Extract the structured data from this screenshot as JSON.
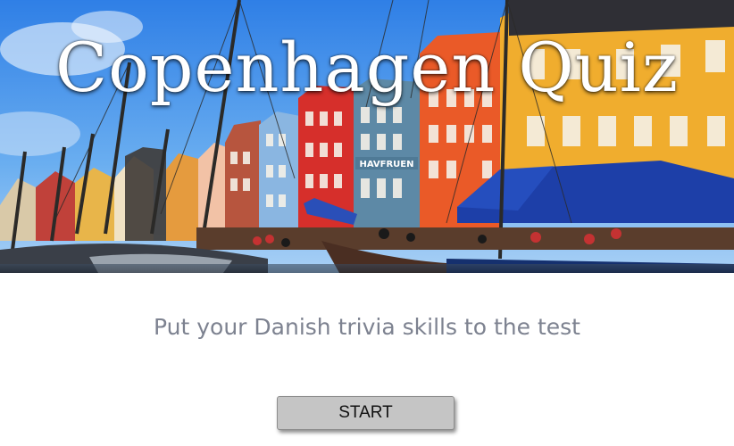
{
  "hero": {
    "title": "Copenhagen Quiz",
    "image_subject": "Nyhavn harbor with colorful waterfront houses and moored sailboats",
    "sign_text": "HAVFRUEN"
  },
  "tagline": "Put your Danish trivia skills to the test",
  "start_button": {
    "label": "START"
  },
  "colors": {
    "tagline": "#7d8290",
    "button_bg": "#c5c5c5",
    "title_text": "#ffffff"
  }
}
